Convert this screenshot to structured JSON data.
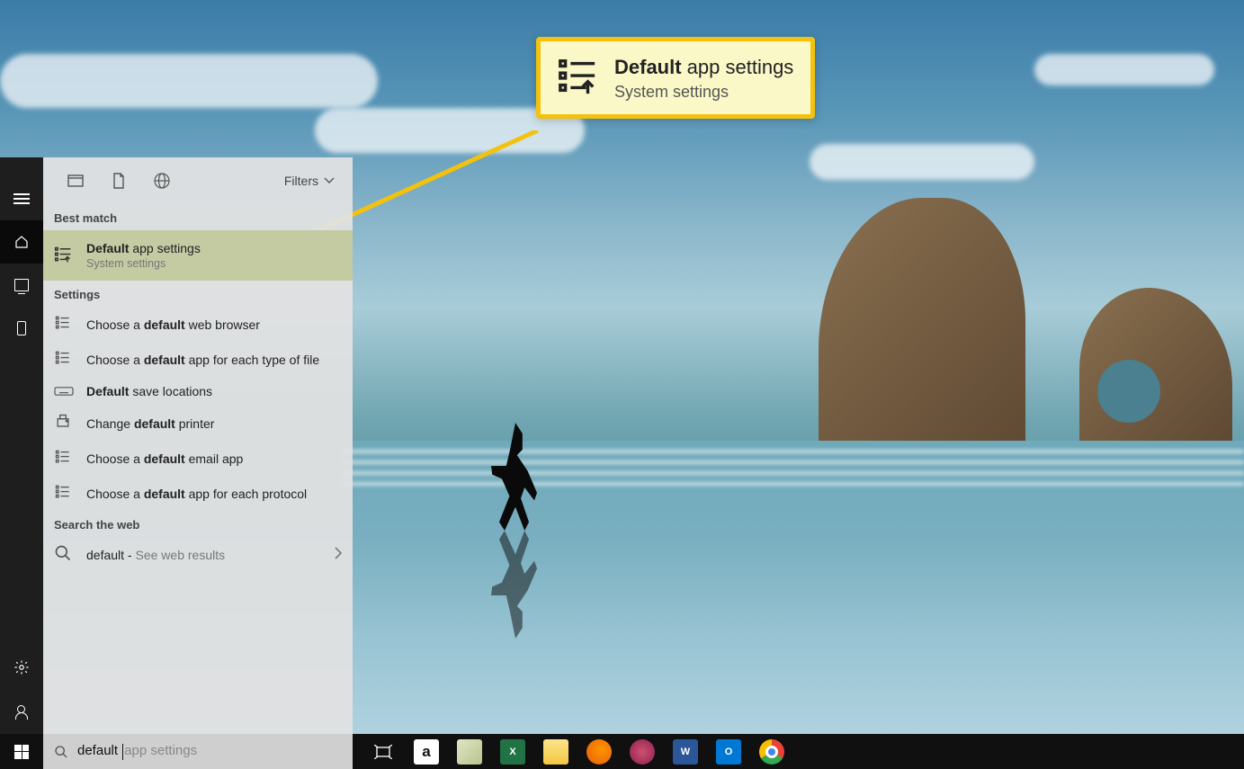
{
  "callout": {
    "title_bold": "Default",
    "title_rest": " app settings",
    "subtitle": "System settings"
  },
  "panel": {
    "filters_label": "Filters",
    "sections": {
      "best_match": "Best match",
      "settings": "Settings",
      "web": "Search the web"
    }
  },
  "best_match": {
    "title_bold": "Default",
    "title_rest": " app settings",
    "subtitle": "System settings"
  },
  "settings_results": [
    {
      "pre": "Choose a ",
      "bold": "default",
      "post": " web browser"
    },
    {
      "pre": "Choose a ",
      "bold": "default",
      "post": " app for each type of file"
    },
    {
      "pre": "",
      "bold": "Default",
      "post": " save locations"
    },
    {
      "pre": "Change ",
      "bold": "default",
      "post": " printer"
    },
    {
      "pre": "Choose a ",
      "bold": "default",
      "post": " email app"
    },
    {
      "pre": "Choose a ",
      "bold": "default",
      "post": " app for each protocol"
    }
  ],
  "web_result": {
    "query": "default",
    "hint": "See web results"
  },
  "search": {
    "typed": "default ",
    "suggestion": "app settings"
  },
  "taskbar_apps": [
    {
      "name": "task-view"
    },
    {
      "name": "amazon"
    },
    {
      "name": "sticky-notes"
    },
    {
      "name": "excel"
    },
    {
      "name": "file-explorer"
    },
    {
      "name": "firefox"
    },
    {
      "name": "snip-sketch"
    },
    {
      "name": "word"
    },
    {
      "name": "outlook"
    },
    {
      "name": "chrome"
    }
  ]
}
